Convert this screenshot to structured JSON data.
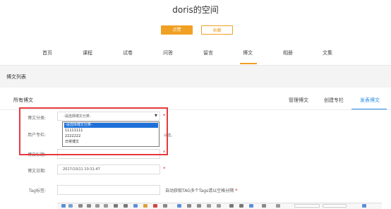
{
  "header": {
    "title": "doris的空间",
    "like_label": "点赞",
    "favorite_label": "收藏"
  },
  "nav": [
    "首页",
    "课程",
    "试卷",
    "问答",
    "留言",
    "博文",
    "相册",
    "文集"
  ],
  "section_label": "博文列表",
  "card": {
    "title": "所有博文",
    "tabs": [
      "管理博文",
      "创建专栏",
      "发表博文"
    ]
  },
  "form": {
    "category_label": "博文分类:",
    "category_value": "-请选择博文分类-",
    "category_options": [
      "-请选择博文分类-",
      "11111111",
      "2222222",
      "日常博文"
    ],
    "column_label": "用户专栏:",
    "column_hint": "以选。",
    "title_label": "博文标题:",
    "date_label": "博文日期:",
    "date_value": "2017/10/11 10:31:47",
    "tags_label": "Tag标签:",
    "tags_hint": "自动获取TAG多个Tags请以空格分隔",
    "required_mark": "*",
    "arrow": "▼"
  },
  "colors": {
    "accent": "#f0a023",
    "link": "#2b8be5",
    "highlight": "#e5393e",
    "option_selected": "#1e70d8"
  }
}
